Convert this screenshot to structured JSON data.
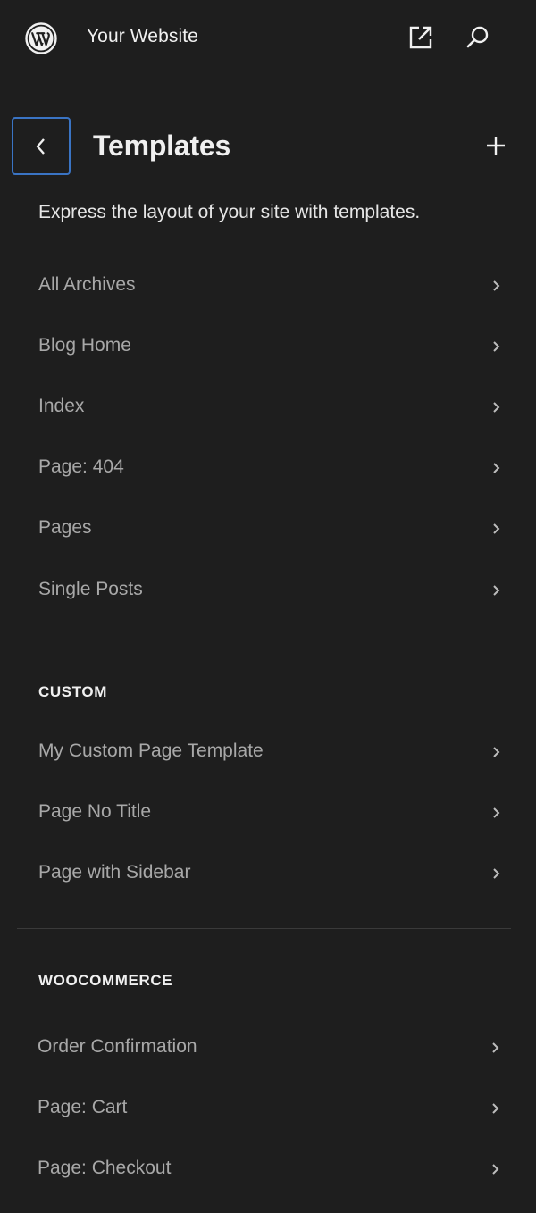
{
  "site": {
    "title": "Your Website"
  },
  "header": {
    "title": "Templates",
    "description": "Express the layout of your site with templates."
  },
  "icons": {
    "logo": "wordpress-logo-icon",
    "external": "external-link-icon",
    "search": "search-icon",
    "back": "chevron-left-icon",
    "add": "plus-icon",
    "item_chevron": "chevron-right-icon"
  },
  "colors": {
    "background": "#1e1e1e",
    "focus_border": "#3a74c4",
    "item_text": "#a8a8a8",
    "heading_text": "#f0f0f0"
  },
  "templates": {
    "items": [
      {
        "label": "All Archives"
      },
      {
        "label": "Blog Home"
      },
      {
        "label": "Index"
      },
      {
        "label": "Page: 404"
      },
      {
        "label": "Pages"
      },
      {
        "label": "Single Posts"
      }
    ]
  },
  "custom": {
    "heading": "CUSTOM",
    "items": [
      {
        "label": "My Custom Page Template"
      },
      {
        "label": "Page No Title"
      },
      {
        "label": "Page with Sidebar"
      }
    ]
  },
  "woocommerce": {
    "heading": "WOOCOMMERCE",
    "items": [
      {
        "label": "Order Confirmation"
      },
      {
        "label": "Page: Cart"
      },
      {
        "label": "Page: Checkout"
      }
    ]
  }
}
